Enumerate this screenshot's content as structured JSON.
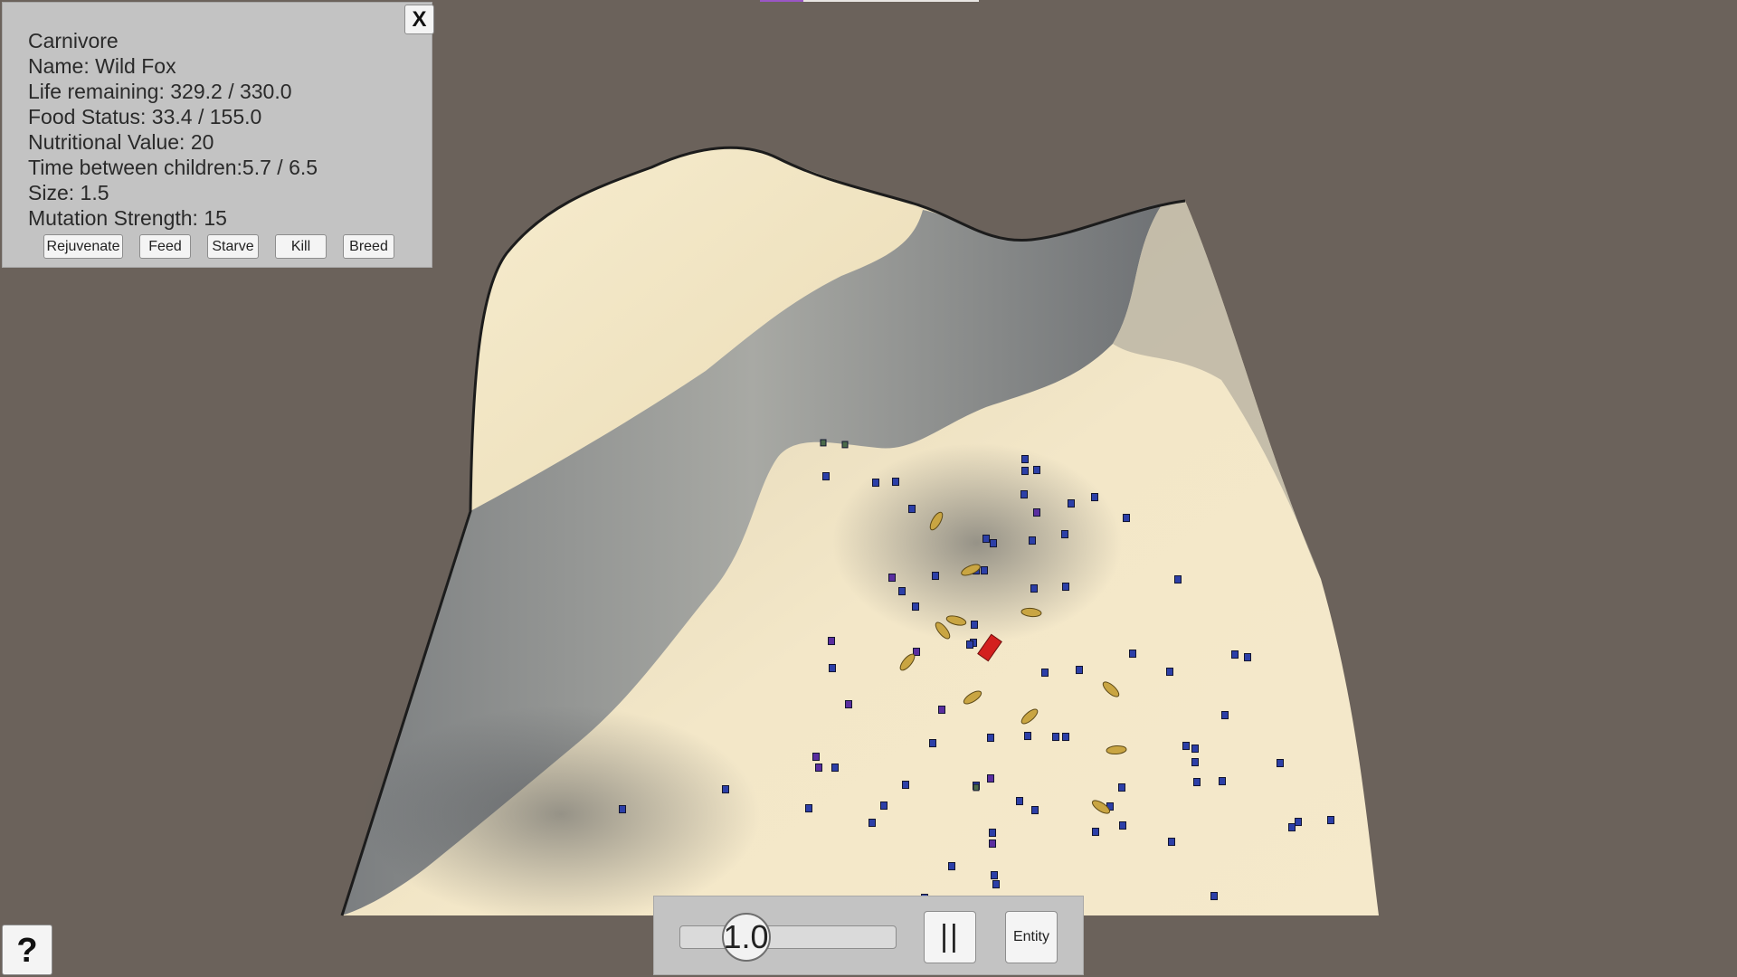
{
  "scene": {
    "background_color": "#6b625b",
    "terrain_light_color": "#f2e6c6",
    "terrain_shadow_color": "#5f6266",
    "entity_colors": {
      "herbivore": "#2c3fa8",
      "herbivore_alt": "#5a2ea0",
      "food": "#c9a542",
      "selected_carnivore": "#d3201e"
    }
  },
  "info_panel": {
    "type_label": "Carnivore",
    "name_line": "Name: Wild Fox",
    "life_line": "Life remaining: 329.2 / 330.0",
    "food_line": "Food Status: 33.4 / 155.0",
    "nutrition_line": "Nutritional Value: 20",
    "children_line": "Time between children:5.7 / 6.5",
    "size_line": "Size: 1.5",
    "mutation_line": "Mutation Strength: 15",
    "close_label": "X",
    "actions": {
      "rejuvenate": "Rejuvenate",
      "feed": "Feed",
      "starve": "Starve",
      "kill": "Kill",
      "breed": "Breed"
    }
  },
  "controls": {
    "speed_value": "1.0",
    "speed_level": 0.25,
    "pause_label": "||",
    "entity_label": "Entity"
  },
  "help": {
    "label": "?"
  }
}
